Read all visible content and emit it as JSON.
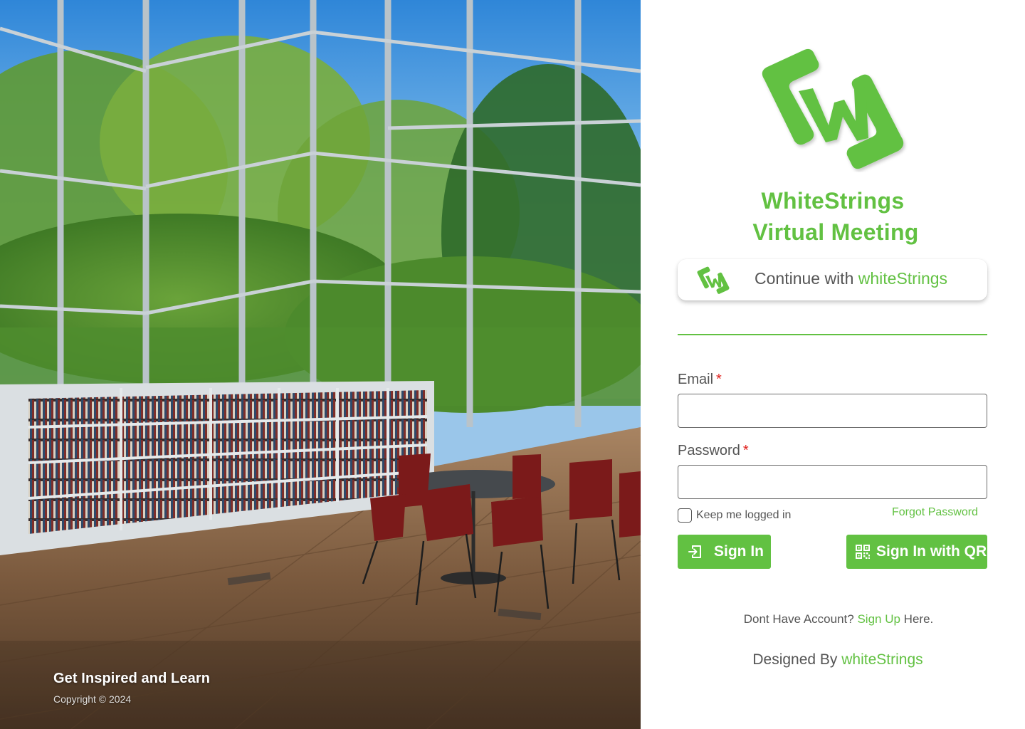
{
  "hero": {
    "tagline": "Get Inspired and Learn",
    "copyright": "Copyright © 2024"
  },
  "brand": {
    "title_line1": "WhiteStrings",
    "title_line2": "Virtual Meeting",
    "color": "#62c142"
  },
  "sso": {
    "prefix": "Continue with ",
    "provider": "whiteStrings"
  },
  "form": {
    "email_label": "Email",
    "password_label": "Password",
    "required_mark": "*",
    "email_value": "",
    "password_value": "",
    "keep_logged_in_label": "Keep me logged in",
    "keep_logged_in_checked": false,
    "forgot_password": "Forgot Password"
  },
  "actions": {
    "sign_in": "Sign In",
    "sign_in_qr": "Sign In with QR",
    "sign_in_icon": "login-icon",
    "qr_icon": "qr-code-icon"
  },
  "signup": {
    "prefix": "Dont Have Account?",
    "link": "Sign Up",
    "suffix": "Here."
  },
  "footer": {
    "designed_prefix": "Designed By",
    "designed_brand": "whiteStrings"
  }
}
